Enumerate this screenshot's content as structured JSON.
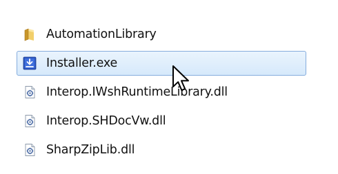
{
  "files": [
    {
      "name": "AutomationLibrary",
      "icon": "folder-icon",
      "selected": false
    },
    {
      "name": "Installer.exe",
      "icon": "installer-exe-icon",
      "selected": true
    },
    {
      "name": "Interop.IWshRuntimeLibrary.dll",
      "icon": "dll-file-icon",
      "selected": false
    },
    {
      "name": "Interop.SHDocVw.dll",
      "icon": "dll-file-icon",
      "selected": false
    },
    {
      "name": "SharpZipLib.dll",
      "icon": "dll-file-icon",
      "selected": false
    }
  ],
  "colors": {
    "selection_fill": "#d6e9fb",
    "selection_border": "#84acdd",
    "folder": "#e8c050",
    "installer": "#2b57c4"
  }
}
